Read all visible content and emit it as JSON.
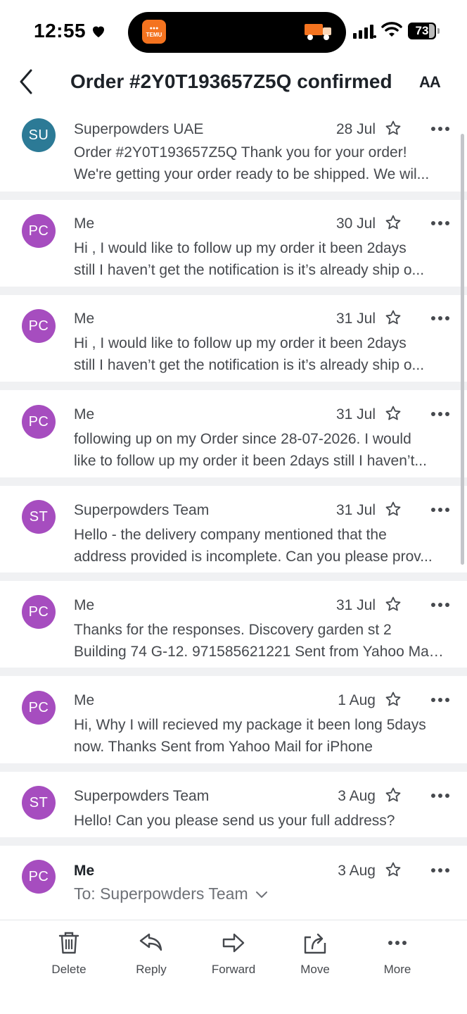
{
  "status_bar": {
    "time": "12:55",
    "temu_label": "TEMU",
    "battery": "73"
  },
  "header": {
    "title": "Order #2Y0T193657Z5Q confirmed",
    "font_size_label": "AA"
  },
  "messages": [
    {
      "avatar": "SU",
      "avatar_color": "#2c7a96",
      "sender": "Superpowders UAE",
      "date": "28 Jul",
      "lines": [
        "Order #2Y0T193657Z5Q Thank you for your order!",
        "We're getting your order ready to be shipped. We wil..."
      ]
    },
    {
      "avatar": "PC",
      "avatar_color": "#a64dbf",
      "sender": "Me",
      "date": "30 Jul",
      "lines": [
        "Hi , I would like to follow up my order it been 2days",
        "still I haven’t get the notification is it’s already ship o..."
      ]
    },
    {
      "avatar": "PC",
      "avatar_color": "#a64dbf",
      "sender": "Me",
      "date": "31 Jul",
      "lines": [
        "Hi , I would like to follow up my order it been 2days",
        "still I haven’t get the notification is it’s already ship o..."
      ]
    },
    {
      "avatar": "PC",
      "avatar_color": "#a64dbf",
      "sender": "Me",
      "date": "31 Jul",
      "lines": [
        "following up on my Order since 28-07-2026. I would",
        "like to follow up my order it been 2days still I haven’t..."
      ]
    },
    {
      "avatar": "ST",
      "avatar_color": "#a64dbf",
      "sender": "Superpowders Team",
      "date": "31 Jul",
      "lines": [
        "Hello - the delivery company mentioned that the",
        "address provided is incomplete. Can you please prov..."
      ]
    },
    {
      "avatar": "PC",
      "avatar_color": "#a64dbf",
      "sender": "Me",
      "date": "31 Jul",
      "lines": [
        "Thanks for the responses. Discovery garden st 2",
        "Building 74 G-12. 971585621221 Sent from Yahoo Mail..."
      ]
    },
    {
      "avatar": "PC",
      "avatar_color": "#a64dbf",
      "sender": "Me",
      "date": "1 Aug",
      "lines": [
        "Hi, Why I will recieved my package it been long 5days",
        "now. Thanks Sent from Yahoo Mail for iPhone"
      ]
    },
    {
      "avatar": "ST",
      "avatar_color": "#a64dbf",
      "sender": "Superpowders Team",
      "date": "3 Aug",
      "lines": [
        "Hello! Can you please send us your full address?"
      ]
    },
    {
      "avatar": "PC",
      "avatar_color": "#a64dbf",
      "sender": "Me",
      "date": "3 Aug",
      "to": "To: Superpowders Team"
    }
  ],
  "toolbar": {
    "delete": "Delete",
    "reply": "Reply",
    "forward": "Forward",
    "move": "Move",
    "more": "More"
  },
  "icons": {
    "back": "chevron-left-icon",
    "star": "star-outline-icon",
    "more": "ellipsis-icon",
    "delete": "trash-icon",
    "reply": "reply-arrow-icon",
    "forward": "forward-arrow-icon",
    "move": "folder-move-icon"
  }
}
